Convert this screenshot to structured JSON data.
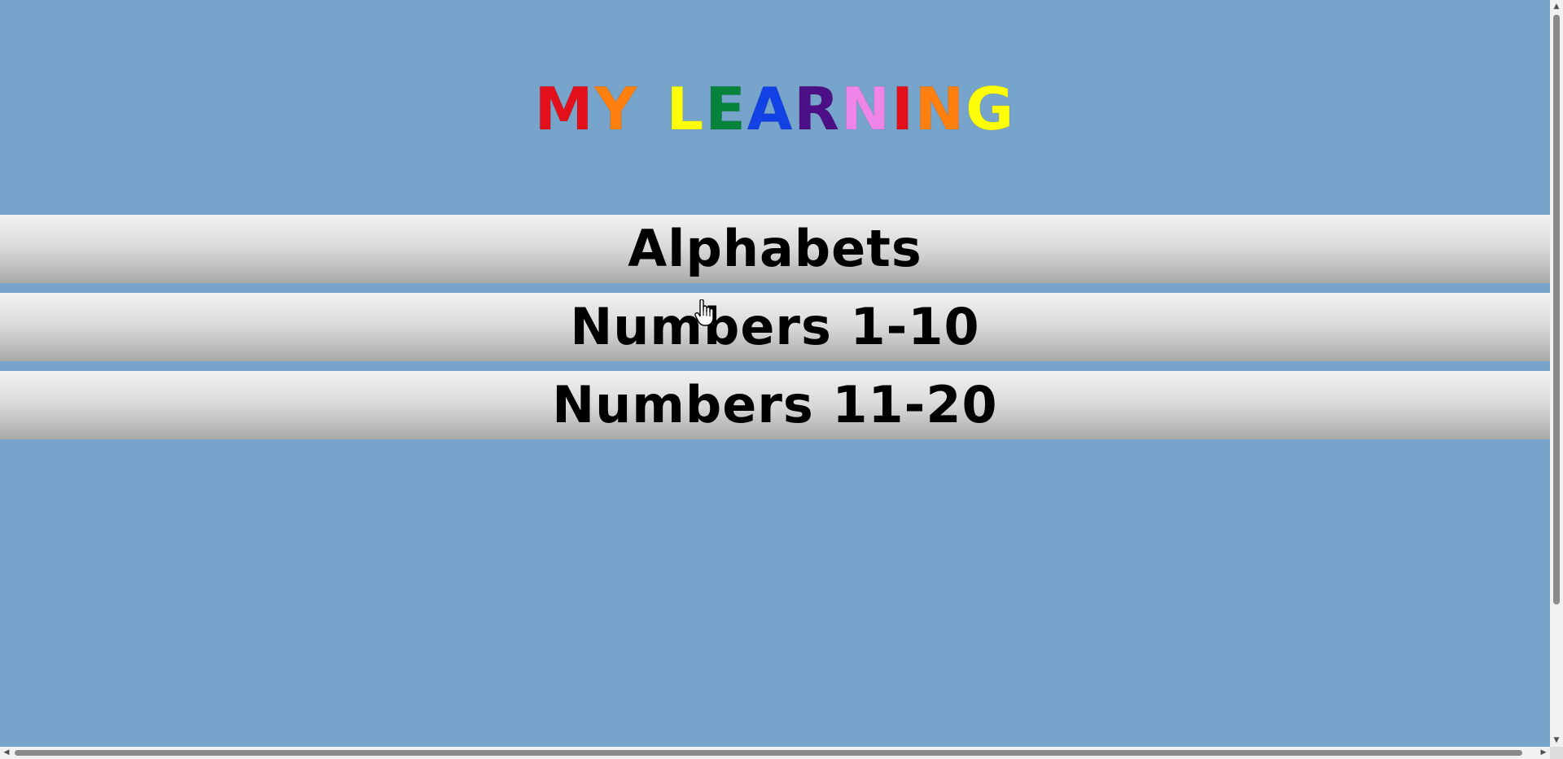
{
  "title": {
    "letters": [
      {
        "char": "M",
        "color": "#e3101b"
      },
      {
        "char": "Y",
        "color": "#ff7f0f"
      },
      {
        "char": " ",
        "color": ""
      },
      {
        "char": "L",
        "color": "#ffff0a"
      },
      {
        "char": "E",
        "color": "#06833b"
      },
      {
        "char": "A",
        "color": "#1241e5"
      },
      {
        "char": "R",
        "color": "#4d0f86"
      },
      {
        "char": "N",
        "color": "#ef85e8"
      },
      {
        "char": "I",
        "color": "#e3101b"
      },
      {
        "char": "N",
        "color": "#ff7f0f"
      },
      {
        "char": "G",
        "color": "#ffff0a"
      }
    ]
  },
  "menu": {
    "items": [
      {
        "label": "Alphabets"
      },
      {
        "label": "Numbers 1-10"
      },
      {
        "label": "Numbers 11-20"
      }
    ]
  },
  "colors": {
    "background": "#76a4cb"
  },
  "icons": {
    "cursor": "hand-pointer-icon"
  }
}
